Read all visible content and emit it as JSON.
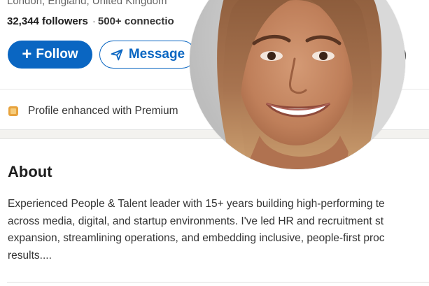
{
  "profile": {
    "location": "London, England, United Kingdom",
    "followers": "32,344 followers",
    "separator": "·",
    "connections": "500+ connectio"
  },
  "actions": {
    "follow_icon": "+",
    "follow_label": "Follow",
    "message_label": "Message",
    "more_glyph": ")"
  },
  "premium": {
    "text": "Profile enhanced with Premium"
  },
  "about": {
    "title": "About",
    "lines": [
      "Experienced People & Talent leader with 15+ years building high-performing te",
      "across media, digital, and startup environments. I've led HR and recruitment st",
      "expansion, streamlining operations, and embedding inclusive, people-first proc",
      "results...."
    ]
  },
  "icons": {
    "follow": "plus-icon",
    "message": "send-icon",
    "premium": "premium-icon"
  },
  "colors": {
    "brand_blue": "#0a66c2",
    "premium_gold": "#e7a33e"
  }
}
